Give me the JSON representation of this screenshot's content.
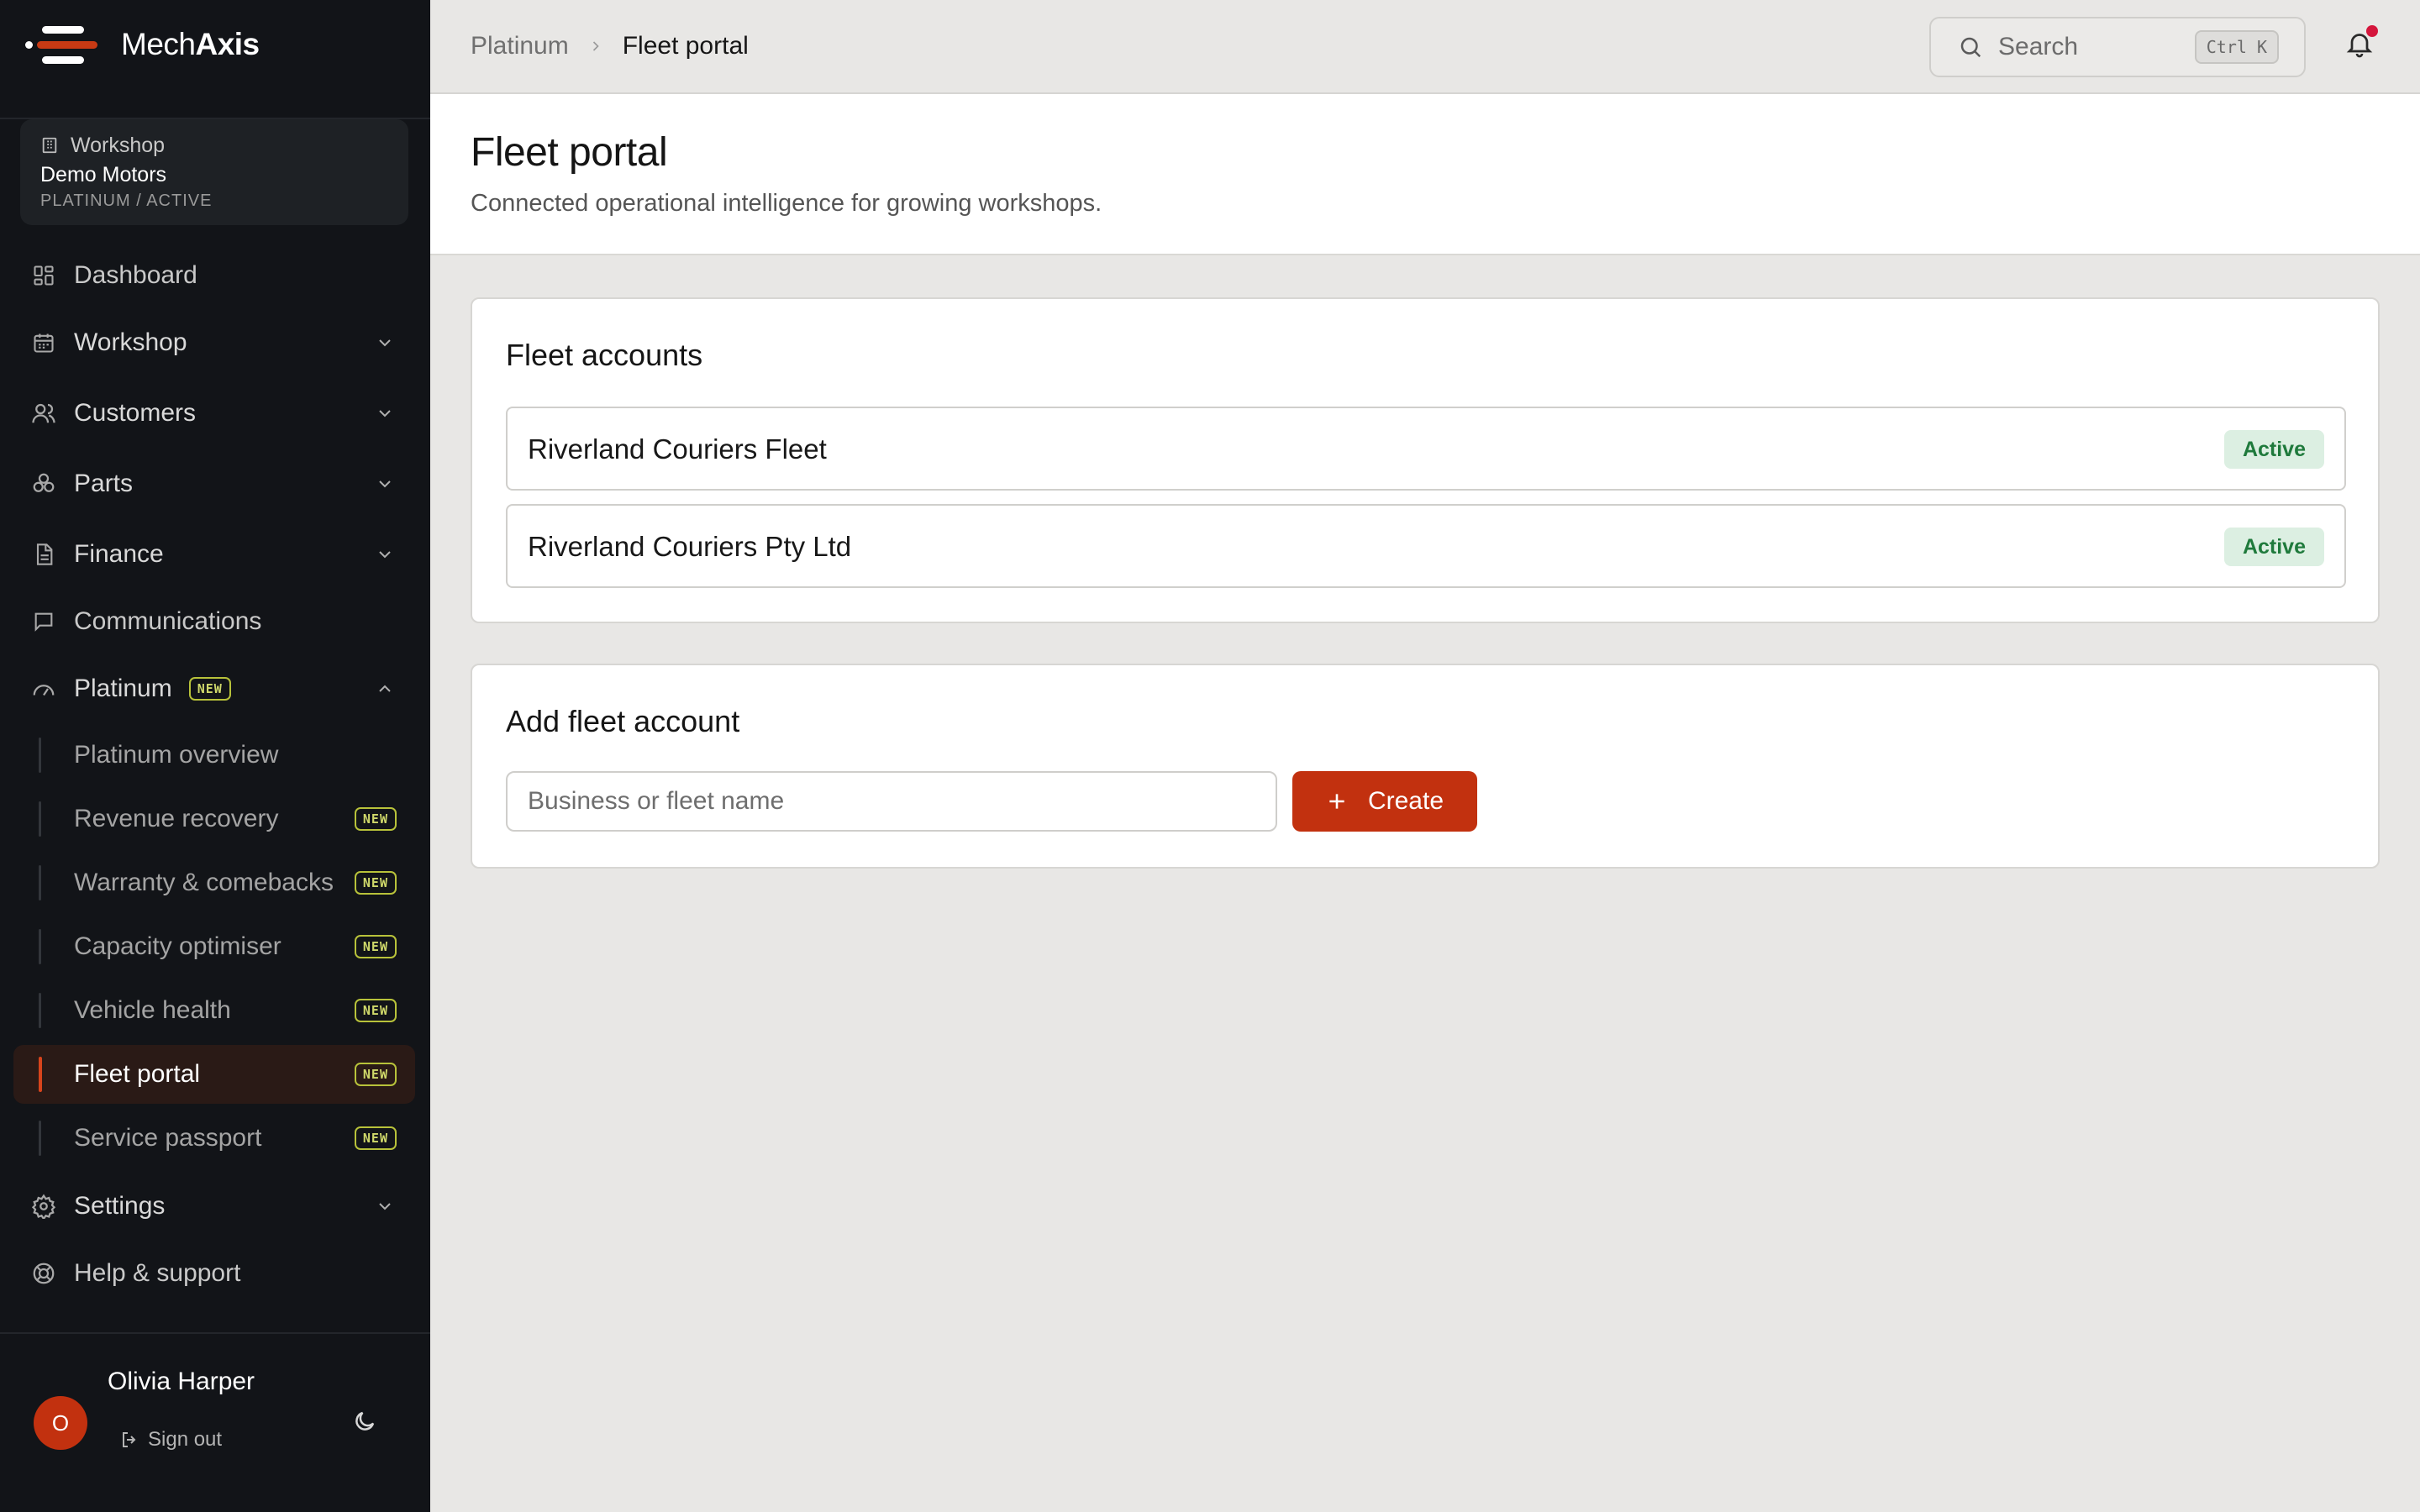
{
  "app": {
    "name_light": "Mech",
    "name_bold": "Axis"
  },
  "workspace": {
    "label": "Workshop",
    "name": "Demo Motors",
    "status": "PLATINUM / ACTIVE"
  },
  "sidebar": {
    "items": [
      {
        "label": "Dashboard",
        "icon": "dashboard-icon"
      },
      {
        "label": "Workshop",
        "icon": "calendar-icon"
      },
      {
        "label": "Customers",
        "icon": "users-icon"
      },
      {
        "label": "Parts",
        "icon": "parts-icon"
      },
      {
        "label": "Finance",
        "icon": "document-icon"
      },
      {
        "label": "Communications",
        "icon": "chat-icon"
      },
      {
        "label": "Platinum",
        "icon": "gauge-icon",
        "badge": "NEW"
      },
      {
        "label": "Settings",
        "icon": "gear-icon"
      },
      {
        "label": "Help & support",
        "icon": "lifebuoy-icon"
      }
    ],
    "platinum_sub": [
      {
        "label": "Platinum overview",
        "badge": ""
      },
      {
        "label": "Revenue recovery",
        "badge": "NEW"
      },
      {
        "label": "Warranty & comebacks",
        "badge": "NEW"
      },
      {
        "label": "Capacity optimiser",
        "badge": "NEW"
      },
      {
        "label": "Vehicle health",
        "badge": "NEW"
      },
      {
        "label": "Fleet portal",
        "badge": "NEW"
      },
      {
        "label": "Service passport",
        "badge": "NEW"
      }
    ]
  },
  "user": {
    "initial": "O",
    "name": "Olivia Harper",
    "signout": "Sign out"
  },
  "header": {
    "breadcrumb": [
      "Platinum",
      "Fleet portal"
    ],
    "search_placeholder": "Search",
    "search_shortcut": "Ctrl K"
  },
  "page": {
    "title": "Fleet portal",
    "subtitle": "Connected operational intelligence for growing workshops."
  },
  "fleet_accounts": {
    "title": "Fleet accounts",
    "rows": [
      {
        "name": "Riverland Couriers Fleet",
        "status": "Active"
      },
      {
        "name": "Riverland Couriers Pty Ltd",
        "status": "Active"
      }
    ]
  },
  "add_fleet": {
    "title": "Add fleet account",
    "placeholder": "Business or fleet name",
    "button": "Create"
  },
  "colors": {
    "accent": "#c2310f",
    "sidebar_bg": "#121418",
    "active_green": "#1f7a3c",
    "notification": "#d4163c"
  }
}
